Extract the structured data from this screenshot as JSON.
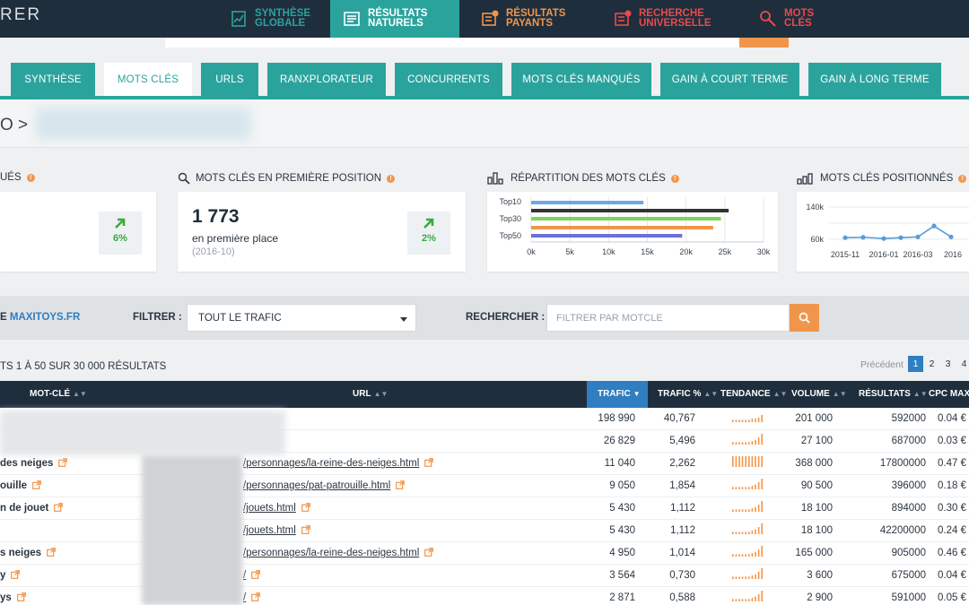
{
  "logo": "RER",
  "topnav": [
    {
      "label": "Synthèse globale",
      "icon": "chart-doc-icon",
      "color": "#2ba39d",
      "active": false
    },
    {
      "label": "Résultats naturels",
      "icon": "list-icon",
      "color": "#ffffff",
      "active": true
    },
    {
      "label": "Résultats payants",
      "icon": "paid-list-icon",
      "color": "#f0964c",
      "active": false
    },
    {
      "label": "Recherche universelle",
      "icon": "universal-list-icon",
      "color": "#e94a4a",
      "active": false
    },
    {
      "label": "Mots clés",
      "icon": "key-search-icon",
      "color": "#e94a4a",
      "active": false
    }
  ],
  "subtabs": [
    {
      "label": "Synthèse",
      "active": false
    },
    {
      "label": "Mots clés",
      "active": true
    },
    {
      "label": "URLs",
      "active": false
    },
    {
      "label": "Ranxplorateur",
      "active": false
    },
    {
      "label": "Concurrents",
      "active": false
    },
    {
      "label": "Mots clés manqués",
      "active": false
    },
    {
      "label": "Gain à court terme",
      "active": false
    },
    {
      "label": "Gain à long terme",
      "active": false
    }
  ],
  "breadcrumb": "O >",
  "cards": {
    "c1": {
      "title": "ués",
      "pct": "6%"
    },
    "c2": {
      "title": "Mots clés en première position",
      "value": "1 773",
      "sublabel": "en première place",
      "date": "(2016-10)",
      "pct": "2%"
    },
    "c3": {
      "title": "Répartition des mots clés"
    },
    "c4": {
      "title": "Mots clés positionnés"
    }
  },
  "chart_data": [
    {
      "type": "bar",
      "orientation": "horizontal",
      "categories": [
        "Top10",
        "Top30",
        "Top50"
      ],
      "tick_labels": [
        "0k",
        "5k",
        "10k",
        "15k",
        "20k",
        "25k",
        "30k"
      ],
      "xlim": [
        0,
        30000
      ],
      "bars": [
        {
          "value": 14500,
          "color": "#6aa7e8"
        },
        {
          "value": 25500,
          "color": "#333333"
        },
        {
          "value": 24500,
          "color": "#7ed35a"
        },
        {
          "value": 23500,
          "color": "#f0964c"
        },
        {
          "value": 19500,
          "color": "#6e6fd8"
        }
      ],
      "grid": true
    },
    {
      "type": "line",
      "y_ticks": [
        "140k",
        "60k"
      ],
      "x_ticks": [
        "2015-11",
        "2016-01",
        "2016-03",
        "2016"
      ],
      "ylim": [
        40000,
        160000
      ],
      "values": [
        64000,
        65000,
        62000,
        64000,
        66000,
        93000,
        66000
      ],
      "color": "#5b9bd8",
      "grid": true
    }
  ],
  "filter": {
    "site_prefix": "E",
    "site": "MAXITOYS.FR",
    "filter_label": "FILTRER :",
    "filter_value": "TOUT LE TRAFIC",
    "search_label": "RECHERCHER :",
    "search_placeholder": "FILTRER PAR MOTCLE"
  },
  "results_text": "TS 1 À 50 SUR 30 000 RÉSULTATS",
  "pagination": {
    "prev": "Précédent",
    "pages": [
      "1",
      "2",
      "3",
      "4"
    ],
    "current": "1"
  },
  "columns": [
    "Mot-clé",
    "URL",
    "Trafic",
    "Trafic %",
    "Tendance",
    "Volume",
    "Résultats",
    "CPC max"
  ],
  "rows": [
    {
      "kw": "",
      "url": "",
      "trafic": "198 990",
      "trafic_pct": "40,767",
      "trend": [
        2,
        2,
        2,
        2,
        2,
        2,
        3,
        3,
        4,
        6
      ],
      "volume": "201 000",
      "results": "592000",
      "cpc": "0.04 €"
    },
    {
      "kw": "",
      "url": "",
      "trafic": "26 829",
      "trafic_pct": "5,496",
      "trend": [
        2,
        2,
        2,
        2,
        2,
        2,
        3,
        4,
        6,
        9
      ],
      "volume": "27 100",
      "results": "687000",
      "cpc": "0.03 €"
    },
    {
      "kw": "des neiges",
      "url": "/personnages/la-reine-des-neiges.html",
      "trafic": "11 040",
      "trafic_pct": "2,262",
      "trend": [
        9,
        9,
        9,
        9,
        9,
        9,
        9,
        9,
        9,
        9
      ],
      "volume": "368 000",
      "results": "17800000",
      "cpc": "0.47 €"
    },
    {
      "kw": "ouille",
      "url": "/personnages/pat-patrouille.html",
      "trafic": "9 050",
      "trafic_pct": "1,854",
      "trend": [
        2,
        2,
        2,
        2,
        2,
        2,
        3,
        4,
        6,
        9
      ],
      "volume": "90 500",
      "results": "396000",
      "cpc": "0.18 €"
    },
    {
      "kw": "n de jouet",
      "url": "/jouets.html",
      "trafic": "5 430",
      "trafic_pct": "1,112",
      "trend": [
        2,
        2,
        2,
        2,
        2,
        2,
        3,
        4,
        6,
        9
      ],
      "volume": "18 100",
      "results": "894000",
      "cpc": "0.30 €"
    },
    {
      "kw": "",
      "url": "/jouets.html",
      "trafic": "5 430",
      "trafic_pct": "1,112",
      "trend": [
        2,
        2,
        2,
        2,
        2,
        2,
        3,
        4,
        6,
        9
      ],
      "volume": "18 100",
      "results": "42200000",
      "cpc": "0.24 €"
    },
    {
      "kw": "s neiges",
      "url": "/personnages/la-reine-des-neiges.html",
      "trafic": "4 950",
      "trafic_pct": "1,014",
      "trend": [
        2,
        2,
        2,
        2,
        2,
        2,
        3,
        4,
        6,
        9
      ],
      "volume": "165 000",
      "results": "905000",
      "cpc": "0.46 €"
    },
    {
      "kw": "y",
      "url": "/",
      "trafic": "3 564",
      "trafic_pct": "0,730",
      "trend": [
        2,
        2,
        2,
        2,
        2,
        2,
        3,
        4,
        6,
        9
      ],
      "volume": "3 600",
      "results": "675000",
      "cpc": "0.04 €"
    },
    {
      "kw": "ys",
      "url": "/",
      "trafic": "2 871",
      "trafic_pct": "0,588",
      "trend": [
        2,
        2,
        2,
        2,
        2,
        2,
        3,
        4,
        6,
        9
      ],
      "volume": "2 900",
      "results": "591000",
      "cpc": "0.05 €"
    }
  ]
}
